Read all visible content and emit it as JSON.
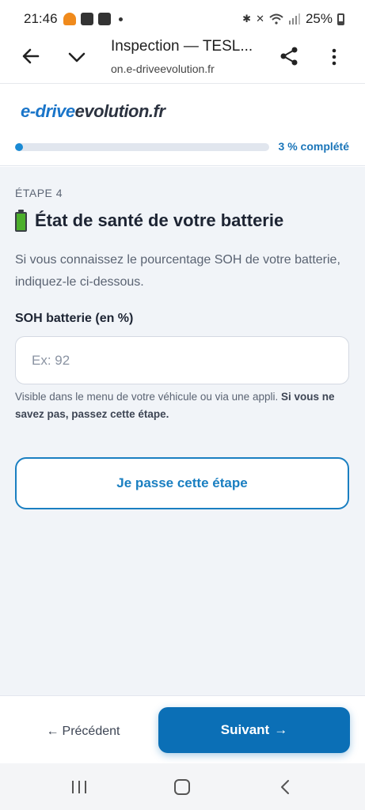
{
  "status_bar": {
    "time": "21:46",
    "battery_percent": "25%",
    "icons": [
      "heart-app-icon",
      "gallery-icon",
      "app-icon",
      "notification-dot",
      "bluetooth-icon",
      "mute-icon",
      "wifi-icon",
      "signal-icon",
      "battery-icon"
    ]
  },
  "browser": {
    "title": "Inspection — TESL...",
    "url": "on.e-driveevolution.fr",
    "icons": [
      "back-arrow-icon",
      "chevron-down-icon",
      "share-icon",
      "more-vert-icon"
    ]
  },
  "header": {
    "logo_prefix": "e-drive",
    "logo_suffix": "evolution.fr",
    "progress_fraction": 0.03,
    "progress_label": "3 % complété",
    "accent_color": "#1a8ad4"
  },
  "step": {
    "label": "ÉTAPE 4",
    "icon": "battery-icon",
    "title": "État de santé de votre batterie",
    "description": "Si vous connaissez le pourcentage SOH de votre batterie, indiquez-le ci-dessous."
  },
  "soh_field": {
    "label": "SOH batterie (en %)",
    "placeholder": "Ex: 92",
    "value": ""
  },
  "help": {
    "text": "Visible dans le menu de votre véhicule ou via une appli. ",
    "bold": "Si vous ne savez pas, passez cette étape."
  },
  "skip_button": "Je passe cette étape",
  "footer": {
    "prev_arrow": "←",
    "prev_label": "Précédent",
    "next_label": "Suivant",
    "next_arrow": "→",
    "primary_color": "#0b6fb6"
  },
  "nav_bar": {
    "icons": [
      "recents-icon",
      "home-icon",
      "back-icon"
    ]
  }
}
